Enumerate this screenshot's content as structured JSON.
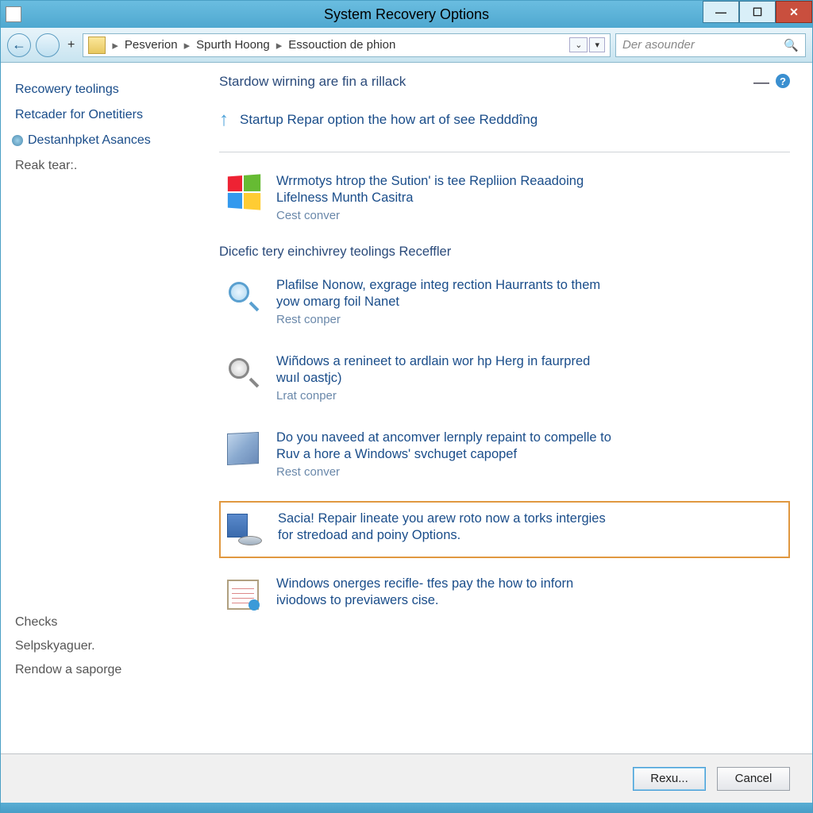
{
  "window": {
    "title": "System Recovery Options"
  },
  "breadcrumbs": {
    "items": [
      "Pesverion",
      "Spurth Hoong",
      "Essouction de phion"
    ]
  },
  "search": {
    "placeholder": "Der asounder"
  },
  "sidebar": {
    "items": [
      {
        "label": "Recowery teolings"
      },
      {
        "label": "Retcader for Onetitiers"
      },
      {
        "label": "Destanhpket Asances"
      },
      {
        "label": "Reak tear:."
      }
    ],
    "bottom": [
      {
        "label": "Checks"
      },
      {
        "label": "Selpskyaguer."
      },
      {
        "label": "Rendow a saporge"
      }
    ]
  },
  "main": {
    "heading": "Stardow wirning are fin a rillack",
    "startup_link": "Startup Repar option the how art of see Redddîng",
    "section_sub": "Dicefic tery einchivrey teolings Receffler",
    "options": [
      {
        "title1": "Wrrmotys htrop the Sution' is tee Repliion Reaadoing",
        "title2": "Lifelness Munth Casitra",
        "action": "Cest conver"
      },
      {
        "title1": "Plafilse Nonow, exgrage integ rection Haurrants to them",
        "title2": "yow omarg foil Nanet",
        "action": "Rest conper"
      },
      {
        "title1": "Wiñdows a renineet to ardlain wor hp Herg in faurpred",
        "title2": "wuıl oastjc)",
        "action": "Lrat conper"
      },
      {
        "title1": "Do you naveed at ancomver lernply repaint to compelle to",
        "title2": "Ruv a hore a Windows' svchuget capopef",
        "action": "Rest conver"
      },
      {
        "title1": "Sacia! Repair lineate you arew roto now a torks intergies",
        "title2": "for stredoad and poiny Options.",
        "action": ""
      },
      {
        "title1": "Windows onerges recifle- tfes pay the how to inforn",
        "title2": "iviodows to previawers cise.",
        "action": ""
      }
    ]
  },
  "footer": {
    "primary": "Rexu...",
    "cancel": "Cancel"
  }
}
